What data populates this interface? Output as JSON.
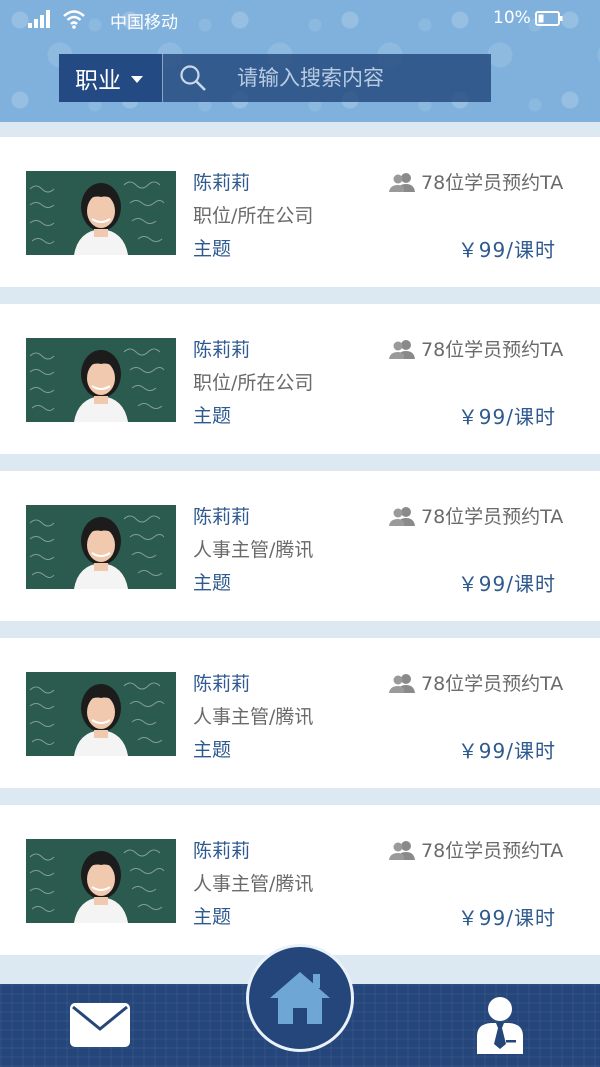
{
  "status_bar": {
    "carrier": "中国移动",
    "battery_percent": "10%",
    "icons": [
      "signal-icon",
      "wifi-icon",
      "battery-icon"
    ]
  },
  "search": {
    "category": "职业",
    "placeholder": "请输入搜索内容",
    "icons": [
      "chevron-down-icon",
      "search-icon"
    ]
  },
  "mentors": [
    {
      "name": "陈莉莉",
      "company": "职位/所在公司",
      "topic": "主题",
      "booked": "78位学员预约TA",
      "price": "￥99/课时"
    },
    {
      "name": "陈莉莉",
      "company": "职位/所在公司",
      "topic": "主题",
      "booked": "78位学员预约TA",
      "price": "￥99/课时"
    },
    {
      "name": "陈莉莉",
      "company": "人事主管/腾讯",
      "topic": "主题",
      "booked": "78位学员预约TA",
      "price": "￥99/课时"
    },
    {
      "name": "陈莉莉",
      "company": "人事主管/腾讯",
      "topic": "主题",
      "booked": "78位学员预约TA",
      "price": "￥99/课时"
    },
    {
      "name": "陈莉莉",
      "company": "人事主管/腾讯",
      "topic": "主题",
      "booked": "78位学员预约TA",
      "price": "￥99/课时"
    }
  ],
  "bottom_nav": {
    "items": [
      "mail-icon",
      "home-icon",
      "profile-icon"
    ]
  },
  "colors": {
    "header": "#7fb1dc",
    "nav": "#24467a",
    "accent_text": "#2f5a8f",
    "muted_text": "#6a6a6a"
  }
}
